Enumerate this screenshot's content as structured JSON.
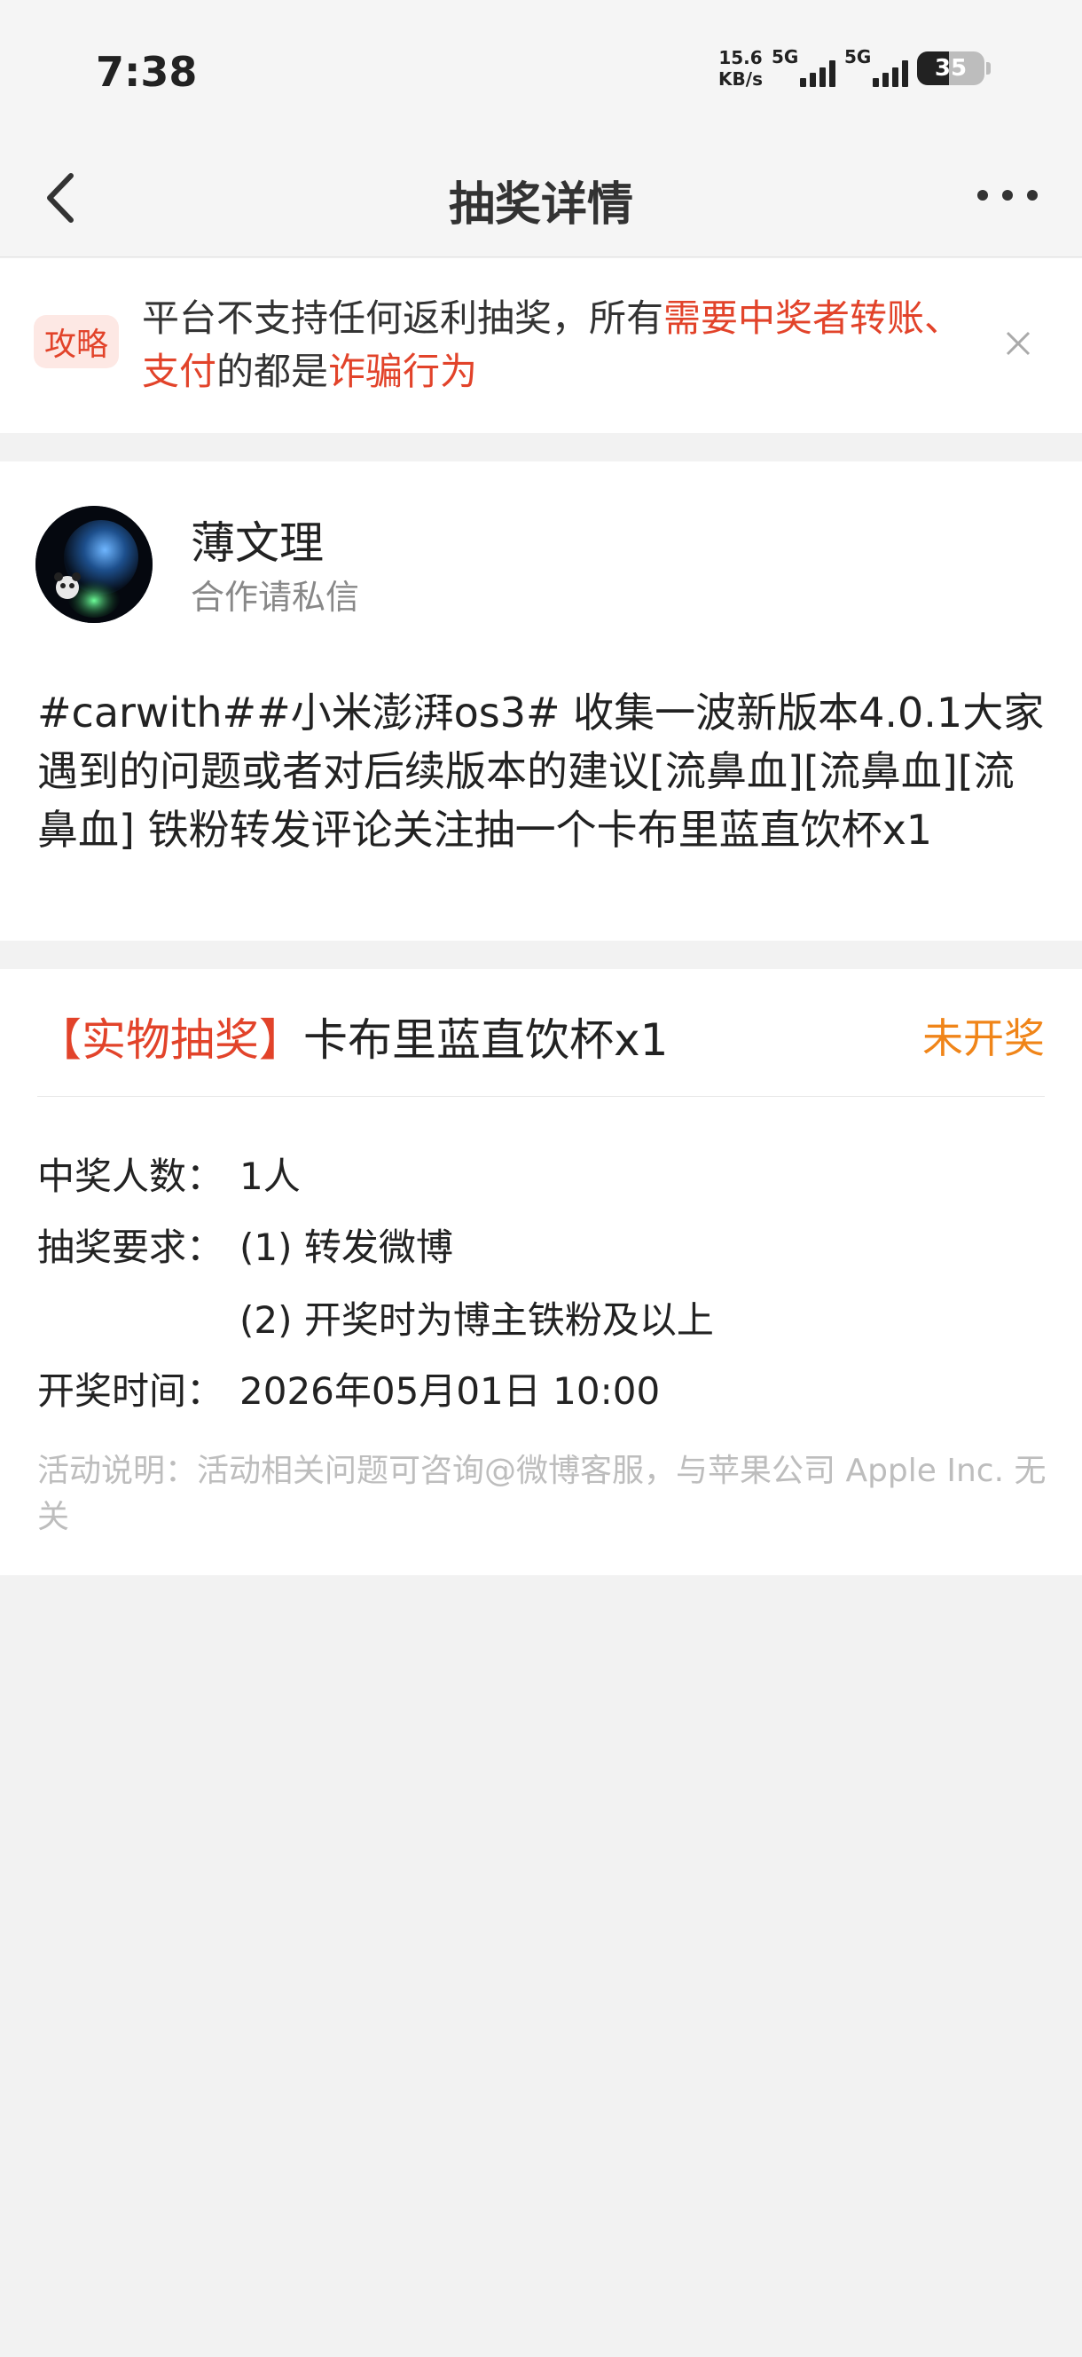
{
  "status_bar": {
    "time": "7:38",
    "net_speed_value": "15.6",
    "net_speed_unit": "KB/s",
    "signal1_label": "5G",
    "signal2_label": "5G",
    "battery": "35"
  },
  "nav": {
    "title": "抽奖详情",
    "back_icon": "chevron-left-icon",
    "more_icon": "more-dots-icon"
  },
  "notice": {
    "tag": "攻略",
    "text_part1": "平台不支持任何返利抽奖，所有",
    "text_red1": "需要中奖者转账、支付",
    "text_part2": "的都是",
    "text_red2": "诈骗行为",
    "close_icon": "close-icon",
    "highlight_color": "#e2432a"
  },
  "post": {
    "user_name": "薄文理",
    "user_subtitle": "合作请私信",
    "content": "#carwith##小米澎湃os3# 收集一波新版本4.0.1大家遇到的问题或者对后续版本的建议[流鼻血][流鼻血][流鼻血] 铁粉转发评论关注抽一个卡布里蓝直饮杯x1"
  },
  "prize": {
    "tag": "【实物抽奖】",
    "title": "卡布里蓝直饮杯x1",
    "status": "未开奖",
    "status_color": "#f08519",
    "winners_label": "中奖人数：",
    "winners_value": "1人",
    "requirements_label": "抽奖要求：",
    "requirement_1": "(1) 转发微博",
    "requirement_2": "(2) 开奖时为博主铁粉及以上",
    "draw_time_label": "开奖时间：",
    "draw_time_value": "2026年05月01日 10:00",
    "disclaimer": "活动说明：活动相关问题可咨询@微博客服，与苹果公司 Apple Inc. 无关"
  }
}
